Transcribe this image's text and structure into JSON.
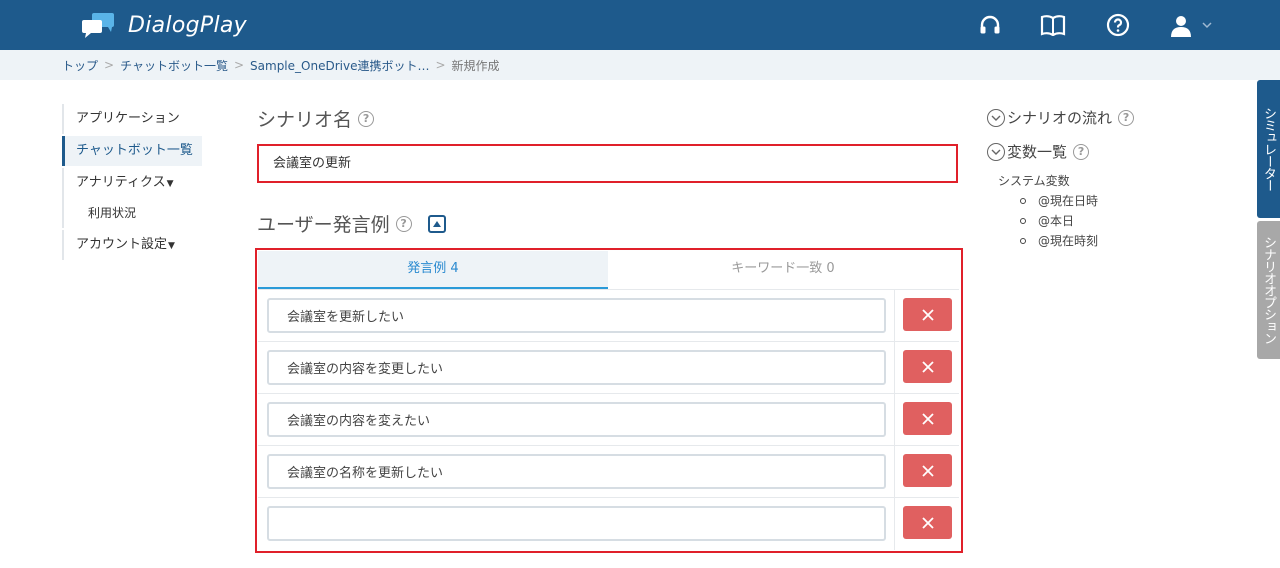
{
  "app": {
    "name": "DialogPlay"
  },
  "header": {
    "icons": [
      "headset-icon",
      "book-icon",
      "help-circle-icon",
      "user-icon",
      "chevron-down-icon"
    ]
  },
  "breadcrumb": {
    "items": [
      "トップ",
      "チャットボット一覧",
      "Sample_OneDrive連携ボット…"
    ],
    "current": "新規作成",
    "separator": ">"
  },
  "sidebar": {
    "items": [
      {
        "label": "アプリケーション"
      },
      {
        "label": "チャットボット一覧"
      },
      {
        "label": "アナリティクス"
      },
      {
        "label": "利用状況"
      },
      {
        "label": "アカウント設定"
      }
    ]
  },
  "scenario": {
    "title": "シナリオ名",
    "value": "会議室の更新"
  },
  "utterances": {
    "title": "ユーザー発言例",
    "tabs": [
      {
        "label": "発言例 4"
      },
      {
        "label": "キーワード一致 0"
      }
    ],
    "rows": [
      {
        "value": "会議室を更新したい"
      },
      {
        "value": "会議室の内容を変更したい"
      },
      {
        "value": "会議室の内容を変えたい"
      },
      {
        "value": "会議室の名称を更新したい"
      },
      {
        "value": ""
      }
    ]
  },
  "right_panel": {
    "flow_title": "シナリオの流れ",
    "vars_title": "変数一覧",
    "system_vars_label": "システム変数",
    "system_vars": [
      "@現在日時",
      "@本日",
      "@現在時刻"
    ]
  },
  "side_tabs": {
    "simulator": "シミュレーター",
    "options": "シナリオオプション"
  },
  "colors": {
    "header_bg": "#1e5a8c",
    "highlight_border": "#e0202a",
    "delete_button": "#e06060",
    "active_tab_text": "#2a8ad0"
  }
}
